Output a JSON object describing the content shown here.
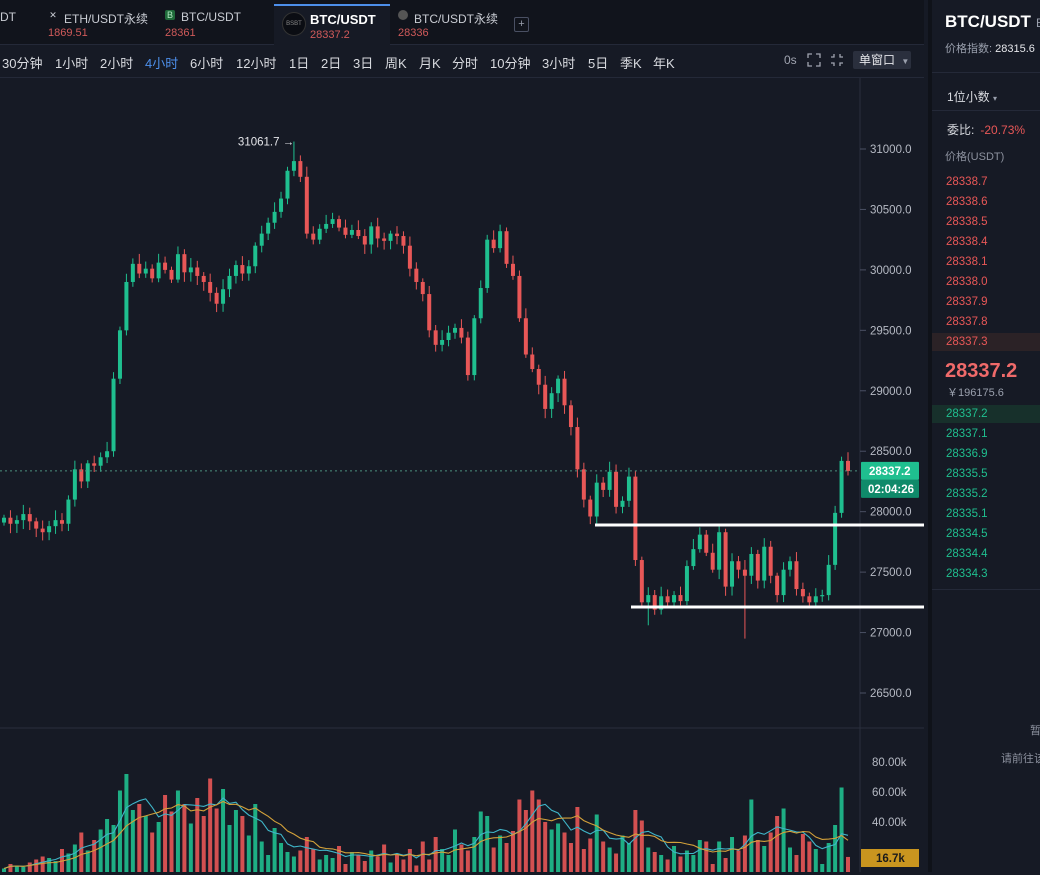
{
  "tabs": [
    {
      "name": "DT",
      "price": ""
    },
    {
      "name": "ETH/USDT永续",
      "price": "1869.51"
    },
    {
      "name": "BTC/USDT",
      "price": "28361"
    },
    {
      "name": "BTC/USDT",
      "price": "28337.2",
      "active": true,
      "badge": "BSBT"
    },
    {
      "name": "BTC/USDT永续",
      "price": "28336"
    }
  ],
  "timeframes": [
    "30分钟",
    "1小时",
    "2小时",
    "4小时",
    "6小时",
    "12小时",
    "1日",
    "2日",
    "3日",
    "周K",
    "月K",
    "分时",
    "10分钟",
    "3小时",
    "5日",
    "季K",
    "年K"
  ],
  "active_timeframe": "4小时",
  "toolbar": {
    "seconds": "0s",
    "window_mode": "单窗口"
  },
  "colors": {
    "up": "#1fbf8f",
    "down": "#e85757",
    "accent": "#4d8fea",
    "ma_yellow": "#d3a13a",
    "ma_cyan": "#3fb5c8"
  },
  "chart_data": {
    "type": "candlestick",
    "price_axis": {
      "ticks": [
        "31000.0",
        "30500.0",
        "30000.0",
        "29500.0",
        "29000.0",
        "28500.0",
        "28000.0",
        "27500.0",
        "27000.0",
        "26500.0"
      ],
      "range": [
        26400,
        31300
      ]
    },
    "volume_axis": {
      "ticks": [
        "80.00k",
        "60.00k",
        "40.00k"
      ]
    },
    "high_marker": "31061.7",
    "last_price": "28337.2",
    "countdown": "02:04:26",
    "last_volume": "16.7k",
    "closes": [
      27950,
      27900,
      27930,
      27980,
      27920,
      27860,
      27830,
      27880,
      27930,
      27900,
      28100,
      28350,
      28250,
      28400,
      28380,
      28450,
      28500,
      29100,
      29500,
      29900,
      30050,
      29970,
      30010,
      29930,
      30060,
      30000,
      29920,
      30130,
      29980,
      30020,
      29950,
      29900,
      29810,
      29720,
      29840,
      29950,
      30040,
      29970,
      30030,
      30200,
      30300,
      30390,
      30480,
      30590,
      30820,
      30900,
      30770,
      30300,
      30250,
      30340,
      30380,
      30420,
      30350,
      30290,
      30330,
      30280,
      30210,
      30360,
      30260,
      30240,
      30300,
      30280,
      30200,
      30010,
      29900,
      29800,
      29500,
      29380,
      29420,
      29480,
      29520,
      29440,
      29130,
      29600,
      29850,
      30250,
      30180,
      30320,
      30050,
      29950,
      29600,
      29300,
      29180,
      29050,
      28850,
      28980,
      29100,
      28880,
      28700,
      28350,
      28100,
      27960,
      28240,
      28180,
      28330,
      28040,
      28090,
      28290,
      27600,
      27250,
      27310,
      27190,
      27300,
      27250,
      27310,
      27260,
      27550,
      27690,
      27810,
      27660,
      27520,
      27830,
      27380,
      27590,
      27520,
      27470,
      27650,
      27430,
      27710,
      27470,
      27310,
      27520,
      27590,
      27360,
      27300,
      27250,
      27300,
      27310,
      27560,
      27990,
      28420,
      28337
    ],
    "volumes": [
      9,
      12,
      11,
      10,
      13,
      15,
      17,
      16,
      14,
      22,
      19,
      25,
      33,
      21,
      28,
      35,
      42,
      38,
      61,
      72,
      48,
      52,
      44,
      33,
      40,
      58,
      47,
      61,
      52,
      39,
      56,
      44,
      69,
      49,
      62,
      38,
      48,
      44,
      31,
      52,
      27,
      18,
      36,
      26,
      20,
      17,
      21,
      30,
      22,
      15,
      18,
      16,
      24,
      12,
      20,
      18,
      14,
      21,
      17,
      25,
      13,
      19,
      15,
      22,
      11,
      27,
      15,
      30,
      22,
      18,
      35,
      25,
      21,
      30,
      47,
      44,
      23,
      31,
      26,
      34,
      55,
      48,
      61,
      55,
      40,
      35,
      39,
      33,
      26,
      50,
      22,
      29,
      45,
      27,
      23,
      19,
      31,
      26,
      48,
      41,
      23,
      20,
      18,
      15,
      24,
      17,
      21,
      18,
      28,
      27,
      12,
      27,
      16,
      30,
      21,
      31,
      55,
      28,
      24,
      33,
      44,
      49,
      23,
      18,
      32,
      27,
      22,
      12,
      26,
      38,
      63,
      16.7
    ]
  },
  "orderbook": {
    "title": "BTC/USDT",
    "title_suffix": "B",
    "index_label": "价格指数:",
    "index_value": "28315.6",
    "decimals": "1位小数",
    "ratio_label": "委比:",
    "ratio_value": "-20.73%",
    "price_header": "价格(USDT)",
    "asks": [
      "28338.7",
      "28338.6",
      "28338.5",
      "28338.4",
      "28338.1",
      "28338.0",
      "28337.9",
      "28337.8",
      "28337.3"
    ],
    "last_price": "28337.2",
    "last_cny": "￥196175.6",
    "bids": [
      "28337.2",
      "28337.1",
      "28336.9",
      "28335.5",
      "28335.2",
      "28335.1",
      "28334.5",
      "28334.4",
      "28334.3"
    ],
    "empty_text": "暂",
    "goto_text": "请前往该"
  }
}
